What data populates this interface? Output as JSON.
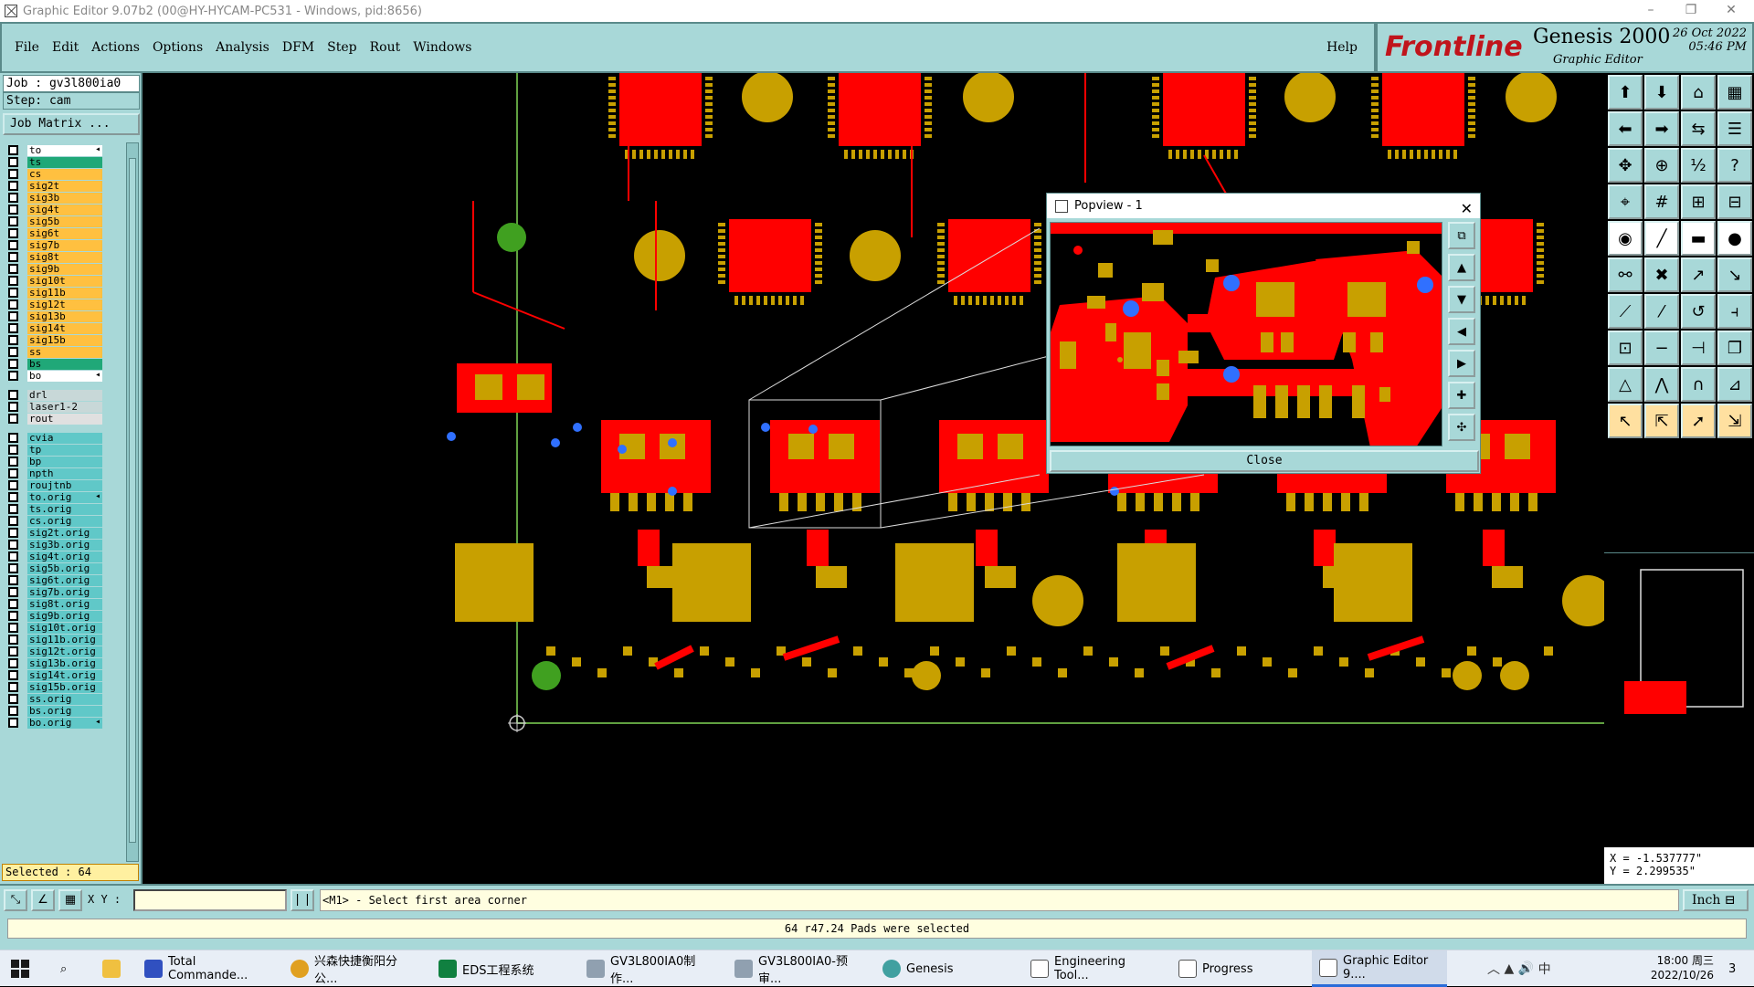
{
  "window": {
    "title": "Graphic Editor 9.07b2 (00@HY-HYCAM-PC531 - Windows, pid:8656)",
    "minimize_icon": "minimize-icon",
    "maximize_icon": "restore-icon",
    "close_icon": "close-icon"
  },
  "menu": {
    "items": [
      "File",
      "Edit",
      "Actions",
      "Options",
      "Analysis",
      "DFM",
      "Step",
      "Rout",
      "Windows"
    ],
    "help": "Help"
  },
  "brand": {
    "logo": "Frontline",
    "product": "Genesis 2000",
    "subtitle": "Graphic Editor",
    "date": "26 Oct 2022",
    "time": "05:46 PM"
  },
  "job": {
    "job_label": "Job : gv3l800ia0",
    "step_label": "Step: cam",
    "matrix_button": "Job Matrix ..."
  },
  "layers": [
    {
      "name": "to",
      "color": "#ffffff",
      "arrow": true
    },
    {
      "name": "ts",
      "color": "#20a878"
    },
    {
      "name": "cs",
      "color": "#ffc040"
    },
    {
      "name": "sig2t",
      "color": "#ffc040"
    },
    {
      "name": "sig3b",
      "color": "#ffc040"
    },
    {
      "name": "sig4t",
      "color": "#ffc040"
    },
    {
      "name": "sig5b",
      "color": "#ffc040"
    },
    {
      "name": "sig6t",
      "color": "#ffc040"
    },
    {
      "name": "sig7b",
      "color": "#ffc040"
    },
    {
      "name": "sig8t",
      "color": "#ffc040"
    },
    {
      "name": "sig9b",
      "color": "#ffc040"
    },
    {
      "name": "sig10t",
      "color": "#ffc040"
    },
    {
      "name": "sig11b",
      "color": "#ffc040"
    },
    {
      "name": "sig12t",
      "color": "#ffc040"
    },
    {
      "name": "sig13b",
      "color": "#ffc040"
    },
    {
      "name": "sig14t",
      "color": "#ffc040"
    },
    {
      "name": "sig15b",
      "color": "#ffc040"
    },
    {
      "name": "ss",
      "color": "#ffc040"
    },
    {
      "name": "bs",
      "color": "#20a878"
    },
    {
      "name": "bo",
      "color": "#ffffff",
      "arrow": true
    },
    {
      "name": "",
      "color": "none",
      "gap": true
    },
    {
      "name": "drl",
      "color": "#c8d8d8"
    },
    {
      "name": "laser1-2",
      "color": "#c8d8d8"
    },
    {
      "name": "rout",
      "color": "#e0e0e0"
    },
    {
      "name": "",
      "color": "none",
      "gap": true
    },
    {
      "name": "cvia",
      "color": "#60c8c8"
    },
    {
      "name": "tp",
      "color": "#60c8c8"
    },
    {
      "name": "bp",
      "color": "#60c8c8"
    },
    {
      "name": "npth",
      "color": "#60c8c8"
    },
    {
      "name": "roujtnb",
      "color": "#60c8c8"
    },
    {
      "name": "to.orig",
      "color": "#60c8c8",
      "arrow": true
    },
    {
      "name": "ts.orig",
      "color": "#60c8c8"
    },
    {
      "name": "cs.orig",
      "color": "#60c8c8"
    },
    {
      "name": "sig2t.orig",
      "color": "#60c8c8"
    },
    {
      "name": "sig3b.orig",
      "color": "#60c8c8"
    },
    {
      "name": "sig4t.orig",
      "color": "#60c8c8"
    },
    {
      "name": "sig5b.orig",
      "color": "#60c8c8"
    },
    {
      "name": "sig6t.orig",
      "color": "#60c8c8"
    },
    {
      "name": "sig7b.orig",
      "color": "#60c8c8"
    },
    {
      "name": "sig8t.orig",
      "color": "#60c8c8"
    },
    {
      "name": "sig9b.orig",
      "color": "#60c8c8"
    },
    {
      "name": "sig10t.orig",
      "color": "#60c8c8"
    },
    {
      "name": "sig11b.orig",
      "color": "#60c8c8"
    },
    {
      "name": "sig12t.orig",
      "color": "#60c8c8"
    },
    {
      "name": "sig13b.orig",
      "color": "#60c8c8"
    },
    {
      "name": "sig14t.orig",
      "color": "#60c8c8"
    },
    {
      "name": "sig15b.orig",
      "color": "#60c8c8"
    },
    {
      "name": "ss.orig",
      "color": "#60c8c8"
    },
    {
      "name": "bs.orig",
      "color": "#60c8c8"
    },
    {
      "name": "bo.orig",
      "color": "#60c8c8",
      "arrow": true
    }
  ],
  "selected_count": "Selected : 64",
  "coords": {
    "x": "X = -1.537777\"",
    "y": "Y = 2.299535\""
  },
  "command": {
    "xy_label": "X Y :",
    "xy_value": "",
    "prompt": "<M1> - Select first area corner",
    "unit": "Inch"
  },
  "status": "64 r47.24 Pads were selected",
  "popview": {
    "title": "Popview - 1",
    "close_button": "Close"
  },
  "colors": {
    "copper": "#ff0000",
    "pad": "#c8a000",
    "highlight": "#3070ff",
    "panel": "#a8d8d8"
  },
  "taskbar": {
    "items": [
      "Total Commande...",
      "兴森快捷衡阳分公...",
      "EDS工程系统",
      "GV3L800IA0制作...",
      "GV3L800IA0-预审...",
      "Genesis",
      "Engineering Tool...",
      "Progress",
      "Graphic Editor 9...."
    ],
    "clock_time": "18:00 周三",
    "clock_date": "2022/10/26",
    "notification_count": "3",
    "ime": "中"
  }
}
